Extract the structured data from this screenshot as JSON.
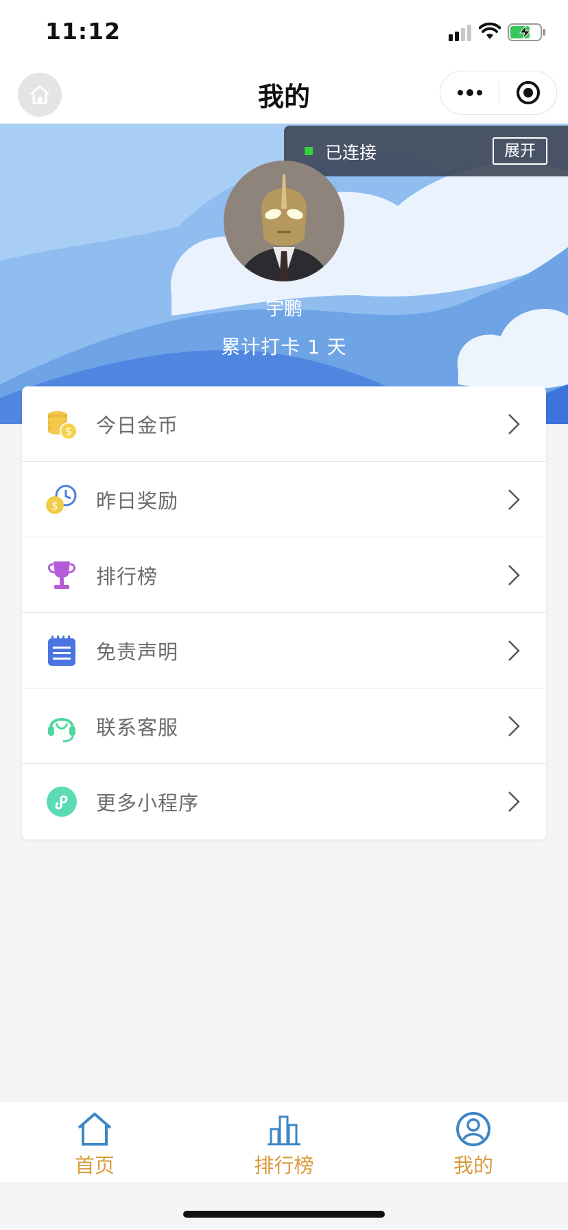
{
  "status_bar": {
    "time": "11:12"
  },
  "nav": {
    "title": "我的"
  },
  "connection": {
    "status": "已连接",
    "expand_label": "展开"
  },
  "profile": {
    "name": "宇鹏",
    "checkin_text": "累计打卡 1 天"
  },
  "menu": [
    {
      "label": "今日金币",
      "icon": "coins-icon"
    },
    {
      "label": "昨日奖励",
      "icon": "coin-clock-icon"
    },
    {
      "label": "排行榜",
      "icon": "trophy-icon"
    },
    {
      "label": "免责声明",
      "icon": "notepad-icon"
    },
    {
      "label": "联系客服",
      "icon": "headset-icon"
    },
    {
      "label": "更多小程序",
      "icon": "mini-program-icon"
    }
  ],
  "tabs": [
    {
      "label": "首页",
      "icon": "home-icon"
    },
    {
      "label": "排行榜",
      "icon": "bar-chart-icon"
    },
    {
      "label": "我的",
      "icon": "user-icon",
      "active": true
    }
  ],
  "colors": {
    "banner_sky": "#8fbdf0",
    "tab_label": "#d99a3b",
    "tab_icon": "#3d86c6",
    "connected": "#34d13f"
  }
}
